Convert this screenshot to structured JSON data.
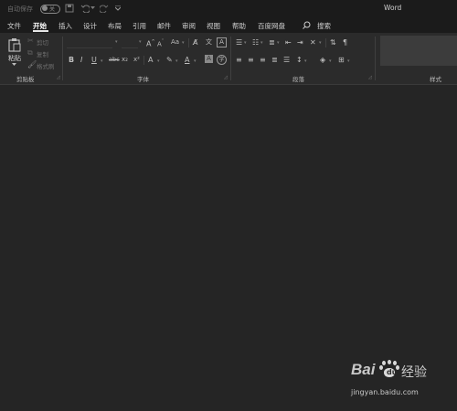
{
  "title": {
    "app_name": "Word",
    "autosave_label": "自动保存",
    "autosave_state": "关"
  },
  "quick_access": {
    "save_icon": "save-icon",
    "undo_icon": "undo-icon",
    "redo_icon": "redo-icon",
    "customize_icon": "chevron-down-icon"
  },
  "tabs": [
    {
      "label": "文件",
      "active": false
    },
    {
      "label": "开始",
      "active": true
    },
    {
      "label": "插入",
      "active": false
    },
    {
      "label": "设计",
      "active": false
    },
    {
      "label": "布局",
      "active": false
    },
    {
      "label": "引用",
      "active": false
    },
    {
      "label": "邮件",
      "active": false
    },
    {
      "label": "审阅",
      "active": false
    },
    {
      "label": "视图",
      "active": false
    },
    {
      "label": "帮助",
      "active": false
    },
    {
      "label": "百度网盘",
      "active": false
    }
  ],
  "search": {
    "label": "搜索",
    "icon": "search-icon"
  },
  "clipboard": {
    "paste_label": "粘贴",
    "cut_label": "剪切",
    "copy_label": "复制",
    "format_painter_label": "格式刷",
    "group_label": "剪贴板"
  },
  "font": {
    "bold": "B",
    "italic": "I",
    "underline": "U",
    "strikethrough": "abc",
    "subscript": "x₂",
    "superscript": "x²",
    "case_label": "Aa",
    "grow_label": "A",
    "shrink_label": "A",
    "group_label": "字体"
  },
  "paragraph": {
    "group_label": "段落"
  },
  "styles": {
    "group_label": "样式"
  },
  "watermark": {
    "brand_left": "Bai",
    "brand_right": "经验",
    "url": "jingyan.baidu.com"
  },
  "colors": {
    "background": "#222222",
    "ribbon": "#2b2b2b",
    "titlebar": "#1b1b1b",
    "active_tab_underline": "#e7e7e7"
  }
}
